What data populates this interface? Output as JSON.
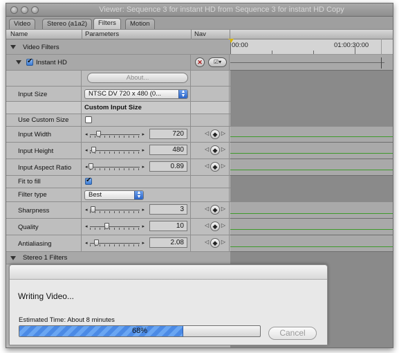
{
  "window": {
    "title": "Viewer: Sequence 3 for instant HD from Sequence 3 for instant HD Copy"
  },
  "tabs": [
    {
      "label": "Video",
      "active": false
    },
    {
      "label": "Stereo (a1a2)",
      "active": false
    },
    {
      "label": "Filters",
      "active": true
    },
    {
      "label": "Motion",
      "active": false
    }
  ],
  "columns": {
    "name": "Name",
    "parameters": "Parameters",
    "nav": "Nav"
  },
  "timeline": {
    "start": "00:00",
    "mark": "01:00:30:00"
  },
  "filters": {
    "video_group": "Video Filters",
    "filter_name": "Instant HD",
    "filter_enabled": true,
    "about_label": "About...",
    "input_size_label": "Input Size",
    "input_size_value": "NTSC DV 720 x 480 (0...",
    "custom_input_header": "Custom Input Size",
    "use_custom_size_label": "Use Custom Size",
    "use_custom_size": false,
    "input_width_label": "Input Width",
    "input_width": "720",
    "input_height_label": "Input Height",
    "input_height": "480",
    "aspect_ratio_label": "Input Aspect Ratio",
    "aspect_ratio": "0.89",
    "fit_to_fill_label": "Fit to fill",
    "fit_to_fill": true,
    "filter_type_label": "Filter type",
    "filter_type_value": "Best",
    "sharpness_label": "Sharpness",
    "sharpness": "3",
    "quality_label": "Quality",
    "quality": "10",
    "antialiasing_label": "Antialiasing",
    "antialiasing": "2.08",
    "stereo_group": "Stereo 1 Filters"
  },
  "progress": {
    "heading": "Writing Video...",
    "estimate": "Estimated Time: About 8 minutes",
    "percent_label": "68%",
    "fraction": 0.68,
    "cancel_label": "Cancel"
  },
  "colors": {
    "accent": "#3a7ad4",
    "keyframe_line": "#3d9a2a"
  }
}
